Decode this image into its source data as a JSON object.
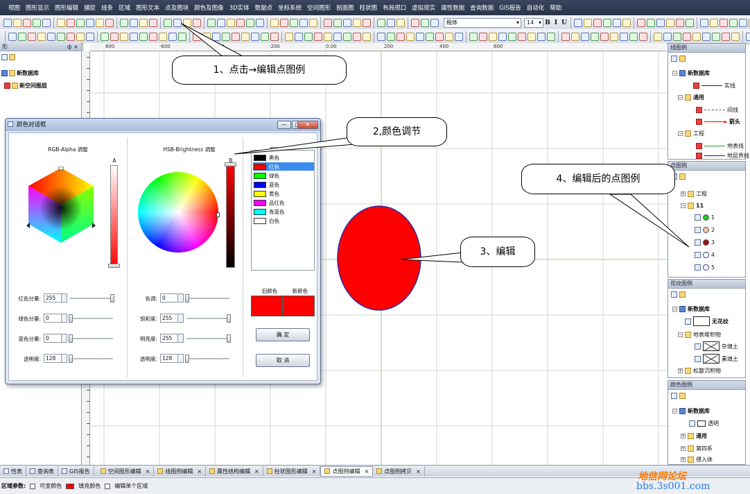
{
  "menubar": {
    "items": [
      "视图",
      "图形显示",
      "图形编辑",
      "捕捉",
      "线条",
      "区域",
      "图形文本",
      "点及图块",
      "颜色及图像",
      "3D实体",
      "数据点",
      "坐标系统",
      "空间图形",
      "剖面图",
      "柱状图",
      "布局视口",
      "虚拟现实",
      "属性数据",
      "查询数据",
      "GIS报告",
      "自动化",
      "帮助"
    ]
  },
  "toolbar": {
    "font_name": "楷体",
    "font_size": "14",
    "bold": "B",
    "italic": "I",
    "underline": "U",
    "align_left": "A",
    "text_a": "A"
  },
  "ruler": {
    "top_labels": [
      "800",
      "-600",
      "-400",
      "-200",
      "0.00",
      "200",
      "400",
      "600"
    ]
  },
  "left_panel": {
    "title": "形",
    "pin": "ф ×",
    "items": [
      "新数据库",
      "新空间图层"
    ]
  },
  "dialog": {
    "title": "颜色对话框",
    "rgb_title": "RGB-Alpha 调整",
    "hsb_title": "HSB-Brightness 调整",
    "alpha_letter": "A",
    "brightness_letter": "B",
    "predefined_title": "预定义颜色",
    "colors": [
      {
        "name": "黑色",
        "swatch": "#000000"
      },
      {
        "name": "红色",
        "swatch": "#ff0000"
      },
      {
        "name": "绿色",
        "swatch": "#00ff00"
      },
      {
        "name": "蓝色",
        "swatch": "#0000ff"
      },
      {
        "name": "黄色",
        "swatch": "#ffff00"
      },
      {
        "name": "品红色",
        "swatch": "#ff00ff"
      },
      {
        "name": "青蓝色",
        "swatch": "#00ffff"
      },
      {
        "name": "白色",
        "swatch": "#ffffff"
      }
    ],
    "selected_color_index": 1,
    "rgb_fields": [
      {
        "label": "红色分量:",
        "value": "255",
        "level": 1.0
      },
      {
        "label": "绿色分量:",
        "value": "0",
        "level": 0.0
      },
      {
        "label": "蓝色分量:",
        "value": "0",
        "level": 0.0
      },
      {
        "label": "透明度:",
        "value": "128",
        "level": 0.0
      }
    ],
    "hsb_fields": [
      {
        "label": "色调:",
        "value": "0",
        "level": 0.0
      },
      {
        "label": "饱和度:",
        "value": "255",
        "level": 1.0
      },
      {
        "label": "明亮度:",
        "value": "255",
        "level": 1.0
      },
      {
        "label": "透明度:",
        "value": "128",
        "level": 0.0
      }
    ],
    "old_color_label": "旧颜色",
    "new_color_label": "新颜色",
    "old_color": "#ff0000",
    "new_color": "#ff0000",
    "ok_label": "确 定",
    "cancel_label": "取 消"
  },
  "canvas": {
    "ellipse_fill": "#ff0000",
    "ellipse_stroke": "#2e2ea8"
  },
  "callouts": {
    "c1": "1、点击→编辑点图例",
    "c2": "2,颜色调节",
    "c3": "3、编辑",
    "c4": "4、编辑后的点图例"
  },
  "right_panels": {
    "line_legend": {
      "title": "线图例",
      "db": "新数据库",
      "items": [
        "实线",
        "通用",
        "间线",
        "箭头",
        "工程",
        "地表线",
        "地层界线"
      ]
    },
    "point_legend": {
      "title": "点图例",
      "groups": [
        "工程",
        "11"
      ],
      "points": [
        {
          "label": "1",
          "color": "#22cc22"
        },
        {
          "label": "2",
          "color": "#f2c4a8"
        },
        {
          "label": "3",
          "color": "#9b1010"
        },
        {
          "label": "4",
          "color": "#ffffff"
        },
        {
          "label": "5",
          "color": "#ffffff"
        }
      ]
    },
    "fill_legend": {
      "title": "花纹图例",
      "db": "新数据库",
      "none_label": "无花纹",
      "group": "地表堆积物",
      "items": [
        "杂填土",
        "素填土"
      ],
      "group2": "松散沉积物"
    },
    "color_legend": {
      "title": "颜色图例",
      "db": "新数据库",
      "items": [
        "透明",
        "通用",
        "第四系",
        "侵入体"
      ]
    }
  },
  "bottom_tabs": {
    "left": [
      "性表",
      "查询表",
      "GIS报告"
    ],
    "tabs": [
      "空间图形编辑",
      "线图例编辑",
      "属性结构编辑",
      "柱状图形编辑",
      "点图例编辑",
      "点图例拷贝"
    ],
    "active_index": 4
  },
  "statusbar": {
    "label": "区域参数:",
    "variable_color": "可变颜色",
    "fill_color": "填充颜色",
    "edit_single": "编辑单个区域"
  },
  "watermark": {
    "line1": "地信网论坛",
    "line2": "bbs.3s001.com"
  }
}
